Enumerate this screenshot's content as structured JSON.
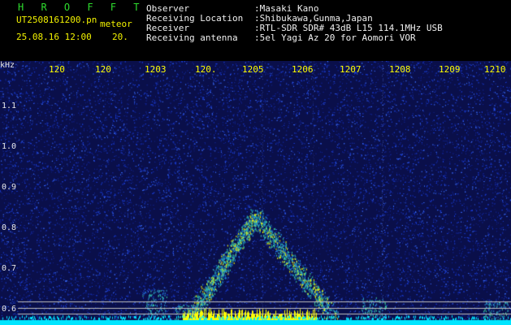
{
  "header": {
    "station_id": "H R O F F T",
    "filename": "UT2508161200.pn",
    "filename_suffix": "meteor",
    "datetime": "25.08.16 12:00",
    "interval": "20.",
    "fields": [
      {
        "label": "Observer",
        "value": ":Masaki Kano"
      },
      {
        "label": "Receiving Location",
        "value": ":Shibukawa,Gunma,Japan"
      },
      {
        "label": "Receiver",
        "value": ":RTL-SDR SDR# 43dB L15 114.1MHz USB"
      },
      {
        "label": "Receiving antenna",
        "value": ":5el Yagi Az 20 for Aomori VOR"
      }
    ]
  },
  "axis": {
    "unit_label": "kHz",
    "y_ticks": [
      "1.1",
      "1.0",
      "0.9",
      "0.8",
      "0.7",
      "0.6"
    ],
    "x_ticks": [
      "120",
      "120",
      "1203",
      "120.",
      "1205",
      "1206",
      "1207",
      "1208",
      "1209",
      "1210"
    ]
  },
  "colors": {
    "background": "#0a0f4a",
    "noise": "#1c3fd8",
    "signal": "#3ad0a0",
    "strong": "#ffff00",
    "floor": "#00e5ff",
    "axis_text": "#ffff00",
    "guide_line": "#c0c0c0"
  },
  "spectrogram": {
    "description_free": true,
    "peak_frequency_khz": 0.84
  }
}
